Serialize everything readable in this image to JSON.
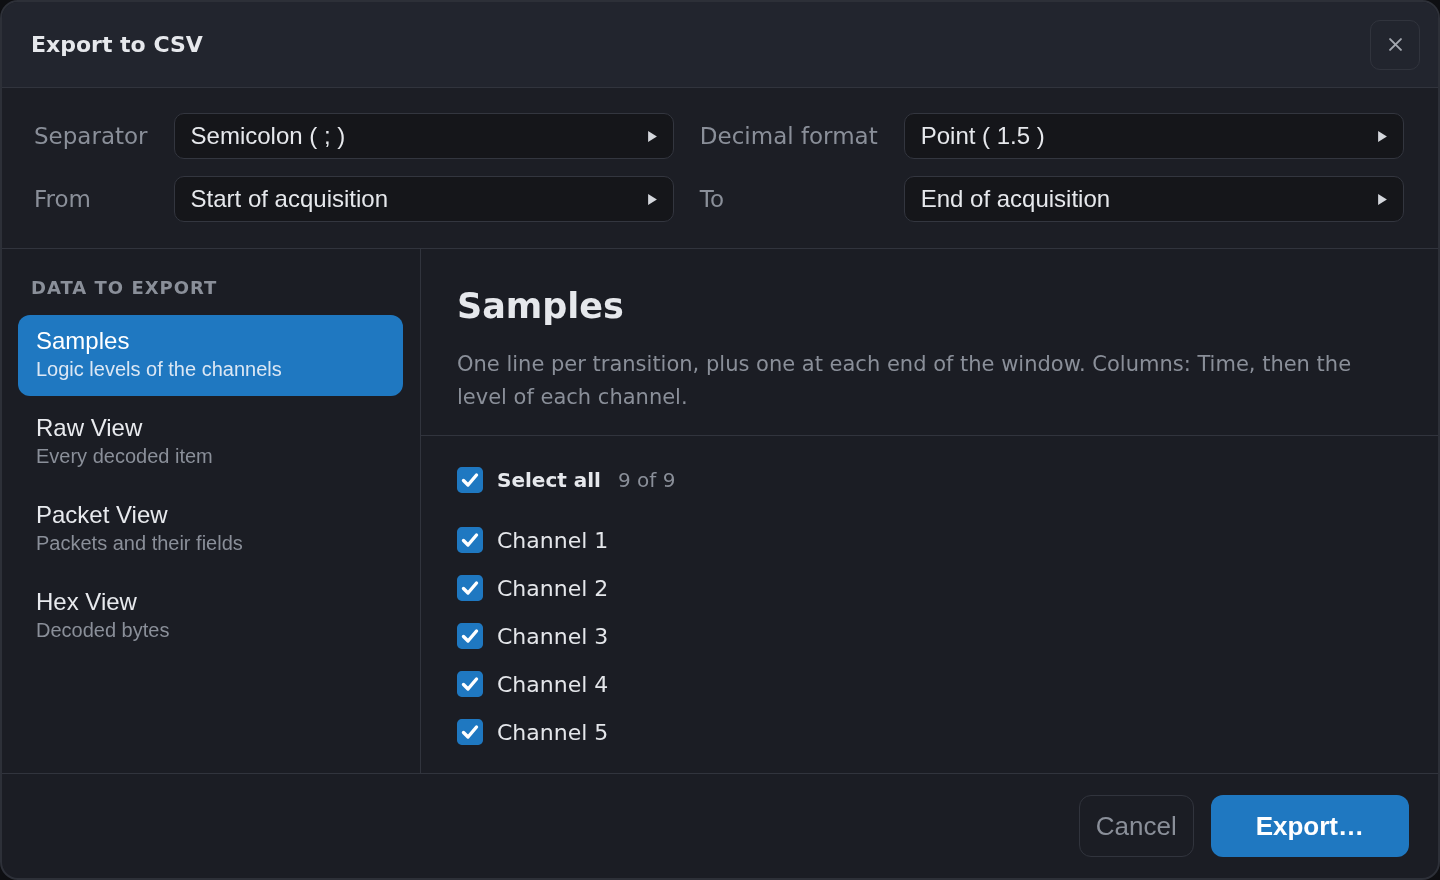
{
  "dialog": {
    "title": "Export to CSV"
  },
  "settings": [
    {
      "label": "Separator",
      "value": "Semicolon ( ; )"
    },
    {
      "label": "Decimal format",
      "value": "Point ( 1.5 )"
    },
    {
      "label": "From",
      "value": "Start of acquisition"
    },
    {
      "label": "To",
      "value": "End of acquisition"
    }
  ],
  "sidebar": {
    "heading": "DATA TO EXPORT",
    "items": [
      {
        "title": "Samples",
        "subtitle": "Logic levels of the channels",
        "selected": true
      },
      {
        "title": "Raw View",
        "subtitle": "Every decoded item",
        "selected": false
      },
      {
        "title": "Packet View",
        "subtitle": "Packets and their fields",
        "selected": false
      },
      {
        "title": "Hex View",
        "subtitle": "Decoded bytes",
        "selected": false
      }
    ]
  },
  "content": {
    "title": "Samples",
    "description": "One line per transition, plus one at each end of the window. Columns: Time, then the level of each channel.",
    "select_all": {
      "label": "Select all",
      "count": "9 of 9",
      "checked": true
    },
    "channels": [
      {
        "name": "Channel 1",
        "checked": true
      },
      {
        "name": "Channel 2",
        "checked": true
      },
      {
        "name": "Channel 3",
        "checked": true
      },
      {
        "name": "Channel 4",
        "checked": true
      },
      {
        "name": "Channel 5",
        "checked": true
      }
    ]
  },
  "footer": {
    "buttons": [
      {
        "label": "Cancel",
        "kind": "secondary"
      },
      {
        "label": "Export…",
        "kind": "primary"
      }
    ]
  }
}
